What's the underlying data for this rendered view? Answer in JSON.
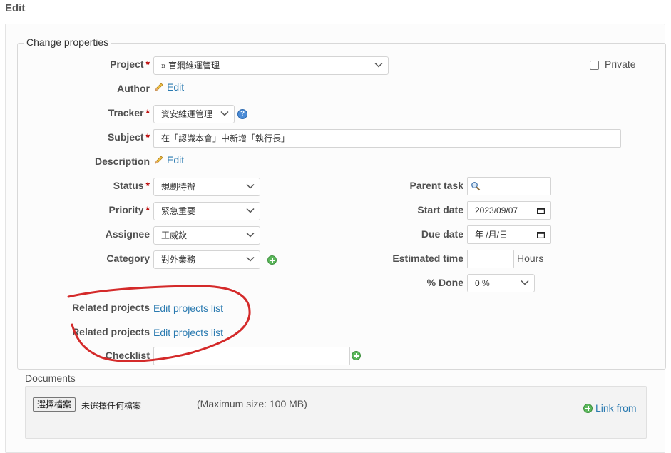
{
  "page": {
    "title": "Edit"
  },
  "form": {
    "legend": "Change properties",
    "project": {
      "label": "Project",
      "required": "*",
      "value": "» 官網維運管理"
    },
    "private": {
      "label": "Private",
      "checked": false
    },
    "author": {
      "label": "Author",
      "edit_label": "Edit"
    },
    "tracker": {
      "label": "Tracker",
      "required": "*",
      "value": "資安維運管理"
    },
    "subject": {
      "label": "Subject",
      "required": "*",
      "value": "在「認識本會」中新增「執行長」"
    },
    "description": {
      "label": "Description",
      "edit_label": "Edit"
    },
    "status": {
      "label": "Status",
      "required": "*",
      "value": "規劃待辦"
    },
    "priority": {
      "label": "Priority",
      "required": "*",
      "value": "緊急重要"
    },
    "assignee": {
      "label": "Assignee",
      "value": "王威欽"
    },
    "category": {
      "label": "Category",
      "value": "對外業務"
    },
    "parent_task": {
      "label": "Parent task",
      "value": ""
    },
    "start_date": {
      "label": "Start date",
      "value": "2023/09/07"
    },
    "due_date": {
      "label": "Due date",
      "value": "年 /月/日"
    },
    "estimated_time": {
      "label": "Estimated time",
      "value": "",
      "unit": "Hours"
    },
    "done": {
      "label": "% Done",
      "value": "0 %"
    },
    "related_projects_1": {
      "label": "Related projects",
      "link": "Edit projects list"
    },
    "related_projects_2": {
      "label": "Related projects",
      "link": "Edit projects list"
    },
    "checklist": {
      "label": "Checklist",
      "value": ""
    }
  },
  "documents": {
    "label": "Documents",
    "choose_file": "選擇檔案",
    "no_file": "未選擇任何檔案",
    "max_size": "(Maximum size: 100 MB)",
    "link_from": "Link from"
  },
  "colors": {
    "link": "#2a7ab0",
    "required": "#bb0000",
    "annotation": "#d42a2a",
    "add": "#5cb85c"
  },
  "icons": [
    "pencil-icon",
    "plus-circle-icon",
    "help-icon",
    "search-icon",
    "calendar-icon",
    "chevron-down-icon"
  ]
}
